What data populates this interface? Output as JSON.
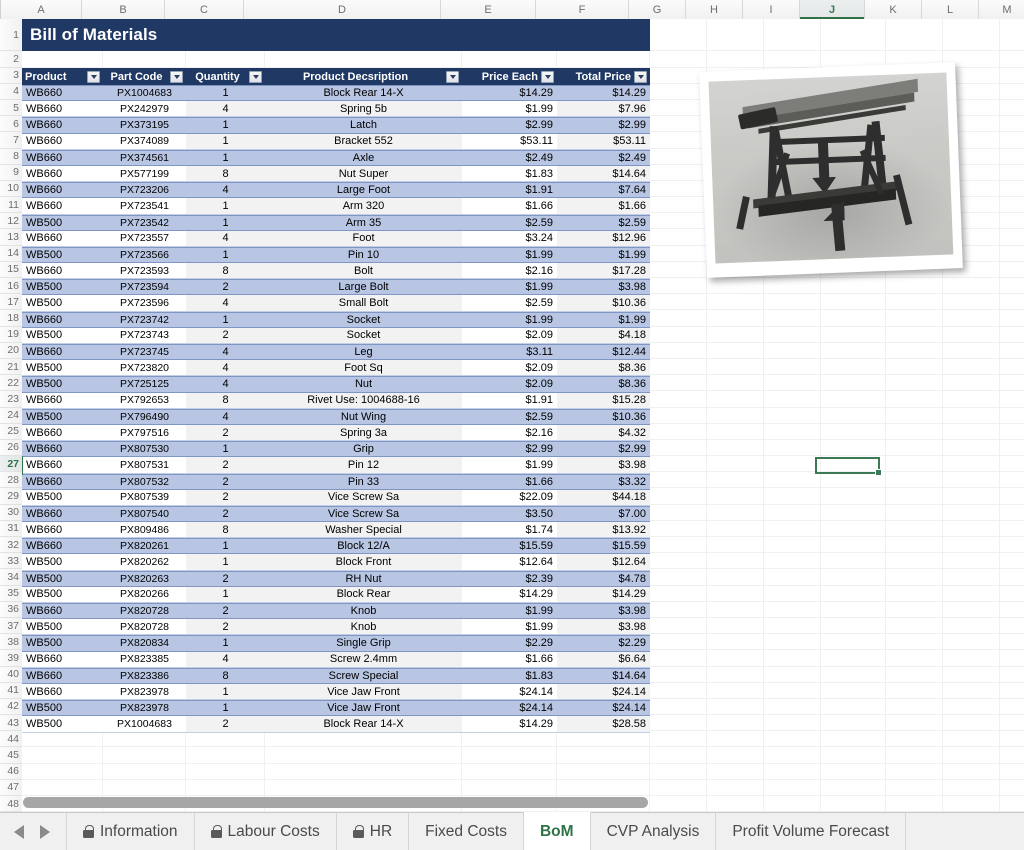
{
  "spreadsheet": {
    "title": "Bill of Materials",
    "column_letters": [
      "A",
      "B",
      "C",
      "D",
      "E",
      "F",
      "G",
      "H",
      "I",
      "J",
      "K",
      "L",
      "M"
    ],
    "active_column": "J",
    "active_row": 27,
    "selected_cell": "J27",
    "row_numbers": [
      1,
      2,
      3,
      4,
      5,
      6,
      7,
      8,
      9,
      10,
      11,
      12,
      13,
      14,
      15,
      16,
      17,
      18,
      19,
      20,
      21,
      22,
      23,
      24,
      25,
      26,
      27,
      28,
      29,
      30,
      31,
      32,
      33,
      34,
      35,
      36,
      37,
      38,
      39,
      40,
      41,
      42,
      43,
      44,
      45,
      46,
      47,
      48
    ],
    "accent_color": "#1f3864",
    "band_color": "#b8c6e4",
    "active_color": "#2f7347"
  },
  "table": {
    "headers": [
      "Product",
      "Part Code",
      "Quantity",
      "Product Decsription",
      "Price Each",
      "Total Price"
    ],
    "filter_icon": "filter-dropdown-icon",
    "rows": [
      {
        "row": 4,
        "product": "WB660",
        "part_code": "PX1004683",
        "quantity": "1",
        "description": "Block Rear 14-X",
        "price_each": "$14.29",
        "total_price": "$14.29",
        "band": true
      },
      {
        "row": 5,
        "product": "WB660",
        "part_code": "PX242979",
        "quantity": "4",
        "description": "Spring 5b",
        "price_each": "$1.99",
        "total_price": "$7.96",
        "band": false
      },
      {
        "row": 6,
        "product": "WB660",
        "part_code": "PX373195",
        "quantity": "1",
        "description": "Latch",
        "price_each": "$2.99",
        "total_price": "$2.99",
        "band": true
      },
      {
        "row": 7,
        "product": "WB660",
        "part_code": "PX374089",
        "quantity": "1",
        "description": "Bracket 552",
        "price_each": "$53.11",
        "total_price": "$53.11",
        "band": false
      },
      {
        "row": 8,
        "product": "WB660",
        "part_code": "PX374561",
        "quantity": "1",
        "description": "Axle",
        "price_each": "$2.49",
        "total_price": "$2.49",
        "band": true
      },
      {
        "row": 9,
        "product": "WB660",
        "part_code": "PX577199",
        "quantity": "8",
        "description": "Nut Super",
        "price_each": "$1.83",
        "total_price": "$14.64",
        "band": false
      },
      {
        "row": 10,
        "product": "WB660",
        "part_code": "PX723206",
        "quantity": "4",
        "description": "Large Foot",
        "price_each": "$1.91",
        "total_price": "$7.64",
        "band": true
      },
      {
        "row": 11,
        "product": "WB660",
        "part_code": "PX723541",
        "quantity": "1",
        "description": "Arm 320",
        "price_each": "$1.66",
        "total_price": "$1.66",
        "band": false
      },
      {
        "row": 12,
        "product": "WB500",
        "part_code": "PX723542",
        "quantity": "1",
        "description": "Arm 35",
        "price_each": "$2.59",
        "total_price": "$2.59",
        "band": true
      },
      {
        "row": 13,
        "product": "WB660",
        "part_code": "PX723557",
        "quantity": "4",
        "description": "Foot",
        "price_each": "$3.24",
        "total_price": "$12.96",
        "band": false
      },
      {
        "row": 14,
        "product": "WB500",
        "part_code": "PX723566",
        "quantity": "1",
        "description": "Pin 10",
        "price_each": "$1.99",
        "total_price": "$1.99",
        "band": true
      },
      {
        "row": 15,
        "product": "WB660",
        "part_code": "PX723593",
        "quantity": "8",
        "description": "Bolt",
        "price_each": "$2.16",
        "total_price": "$17.28",
        "band": false
      },
      {
        "row": 16,
        "product": "WB500",
        "part_code": "PX723594",
        "quantity": "2",
        "description": "Large Bolt",
        "price_each": "$1.99",
        "total_price": "$3.98",
        "band": true
      },
      {
        "row": 17,
        "product": "WB500",
        "part_code": "PX723596",
        "quantity": "4",
        "description": "Small Bolt",
        "price_each": "$2.59",
        "total_price": "$10.36",
        "band": false
      },
      {
        "row": 18,
        "product": "WB660",
        "part_code": "PX723742",
        "quantity": "1",
        "description": "Socket",
        "price_each": "$1.99",
        "total_price": "$1.99",
        "band": true
      },
      {
        "row": 19,
        "product": "WB500",
        "part_code": "PX723743",
        "quantity": "2",
        "description": "Socket",
        "price_each": "$2.09",
        "total_price": "$4.18",
        "band": false
      },
      {
        "row": 20,
        "product": "WB660",
        "part_code": "PX723745",
        "quantity": "4",
        "description": "Leg",
        "price_each": "$3.11",
        "total_price": "$12.44",
        "band": true
      },
      {
        "row": 21,
        "product": "WB500",
        "part_code": "PX723820",
        "quantity": "4",
        "description": "Foot Sq",
        "price_each": "$2.09",
        "total_price": "$8.36",
        "band": false
      },
      {
        "row": 22,
        "product": "WB500",
        "part_code": "PX725125",
        "quantity": "4",
        "description": "Nut",
        "price_each": "$2.09",
        "total_price": "$8.36",
        "band": true
      },
      {
        "row": 23,
        "product": "WB660",
        "part_code": "PX792653",
        "quantity": "8",
        "description": "Rivet Use: 1004688-16",
        "price_each": "$1.91",
        "total_price": "$15.28",
        "band": false
      },
      {
        "row": 24,
        "product": "WB500",
        "part_code": "PX796490",
        "quantity": "4",
        "description": "Nut Wing",
        "price_each": "$2.59",
        "total_price": "$10.36",
        "band": true
      },
      {
        "row": 25,
        "product": "WB660",
        "part_code": "PX797516",
        "quantity": "2",
        "description": "Spring 3a",
        "price_each": "$2.16",
        "total_price": "$4.32",
        "band": false
      },
      {
        "row": 26,
        "product": "WB660",
        "part_code": "PX807530",
        "quantity": "1",
        "description": "Grip",
        "price_each": "$2.99",
        "total_price": "$2.99",
        "band": true
      },
      {
        "row": 27,
        "product": "WB660",
        "part_code": "PX807531",
        "quantity": "2",
        "description": "Pin 12",
        "price_each": "$1.99",
        "total_price": "$3.98",
        "band": false
      },
      {
        "row": 28,
        "product": "WB660",
        "part_code": "PX807532",
        "quantity": "2",
        "description": "Pin 33",
        "price_each": "$1.66",
        "total_price": "$3.32",
        "band": true
      },
      {
        "row": 29,
        "product": "WB500",
        "part_code": "PX807539",
        "quantity": "2",
        "description": "Vice Screw Sa",
        "price_each": "$22.09",
        "total_price": "$44.18",
        "band": false
      },
      {
        "row": 30,
        "product": "WB660",
        "part_code": "PX807540",
        "quantity": "2",
        "description": "Vice Screw Sa",
        "price_each": "$3.50",
        "total_price": "$7.00",
        "band": true
      },
      {
        "row": 31,
        "product": "WB660",
        "part_code": "PX809486",
        "quantity": "8",
        "description": "Washer Special",
        "price_each": "$1.74",
        "total_price": "$13.92",
        "band": false
      },
      {
        "row": 32,
        "product": "WB660",
        "part_code": "PX820261",
        "quantity": "1",
        "description": "Block 12/A",
        "price_each": "$15.59",
        "total_price": "$15.59",
        "band": true
      },
      {
        "row": 33,
        "product": "WB500",
        "part_code": "PX820262",
        "quantity": "1",
        "description": "Block Front",
        "price_each": "$12.64",
        "total_price": "$12.64",
        "band": false
      },
      {
        "row": 34,
        "product": "WB500",
        "part_code": "PX820263",
        "quantity": "2",
        "description": "RH Nut",
        "price_each": "$2.39",
        "total_price": "$4.78",
        "band": true
      },
      {
        "row": 35,
        "product": "WB500",
        "part_code": "PX820266",
        "quantity": "1",
        "description": "Block Rear",
        "price_each": "$14.29",
        "total_price": "$14.29",
        "band": false
      },
      {
        "row": 36,
        "product": "WB660",
        "part_code": "PX820728",
        "quantity": "2",
        "description": "Knob",
        "price_each": "$1.99",
        "total_price": "$3.98",
        "band": true
      },
      {
        "row": 37,
        "product": "WB500",
        "part_code": "PX820728",
        "quantity": "2",
        "description": "Knob",
        "price_each": "$1.99",
        "total_price": "$3.98",
        "band": false
      },
      {
        "row": 38,
        "product": "WB500",
        "part_code": "PX820834",
        "quantity": "1",
        "description": "Single Grip",
        "price_each": "$2.29",
        "total_price": "$2.29",
        "band": true
      },
      {
        "row": 39,
        "product": "WB660",
        "part_code": "PX823385",
        "quantity": "4",
        "description": "Screw 2.4mm",
        "price_each": "$1.66",
        "total_price": "$6.64",
        "band": false
      },
      {
        "row": 40,
        "product": "WB660",
        "part_code": "PX823386",
        "quantity": "8",
        "description": "Screw Special",
        "price_each": "$1.83",
        "total_price": "$14.64",
        "band": true
      },
      {
        "row": 41,
        "product": "WB660",
        "part_code": "PX823978",
        "quantity": "1",
        "description": "Vice Jaw Front",
        "price_each": "$24.14",
        "total_price": "$24.14",
        "band": false
      },
      {
        "row": 42,
        "product": "WB500",
        "part_code": "PX823978",
        "quantity": "1",
        "description": "Vice Jaw Front",
        "price_each": "$24.14",
        "total_price": "$24.14",
        "band": true
      },
      {
        "row": 43,
        "product": "WB500",
        "part_code": "PX1004683",
        "quantity": "2",
        "description": "Block Rear 14-X",
        "price_each": "$14.29",
        "total_price": "$28.58",
        "band": false
      }
    ]
  },
  "picture": {
    "alt": "workbench-frame-photo"
  },
  "tabbar": {
    "prev_label": "previous-sheet-arrow",
    "next_label": "next-sheet-arrow",
    "tabs": [
      {
        "label": "Information",
        "locked": true,
        "active": false
      },
      {
        "label": "Labour Costs",
        "locked": true,
        "active": false
      },
      {
        "label": "HR",
        "locked": true,
        "active": false
      },
      {
        "label": "Fixed Costs",
        "locked": false,
        "active": false
      },
      {
        "label": "BoM",
        "locked": false,
        "active": true
      },
      {
        "label": "CVP Analysis",
        "locked": false,
        "active": false
      },
      {
        "label": "Profit Volume Forecast",
        "locked": false,
        "active": false
      }
    ]
  }
}
